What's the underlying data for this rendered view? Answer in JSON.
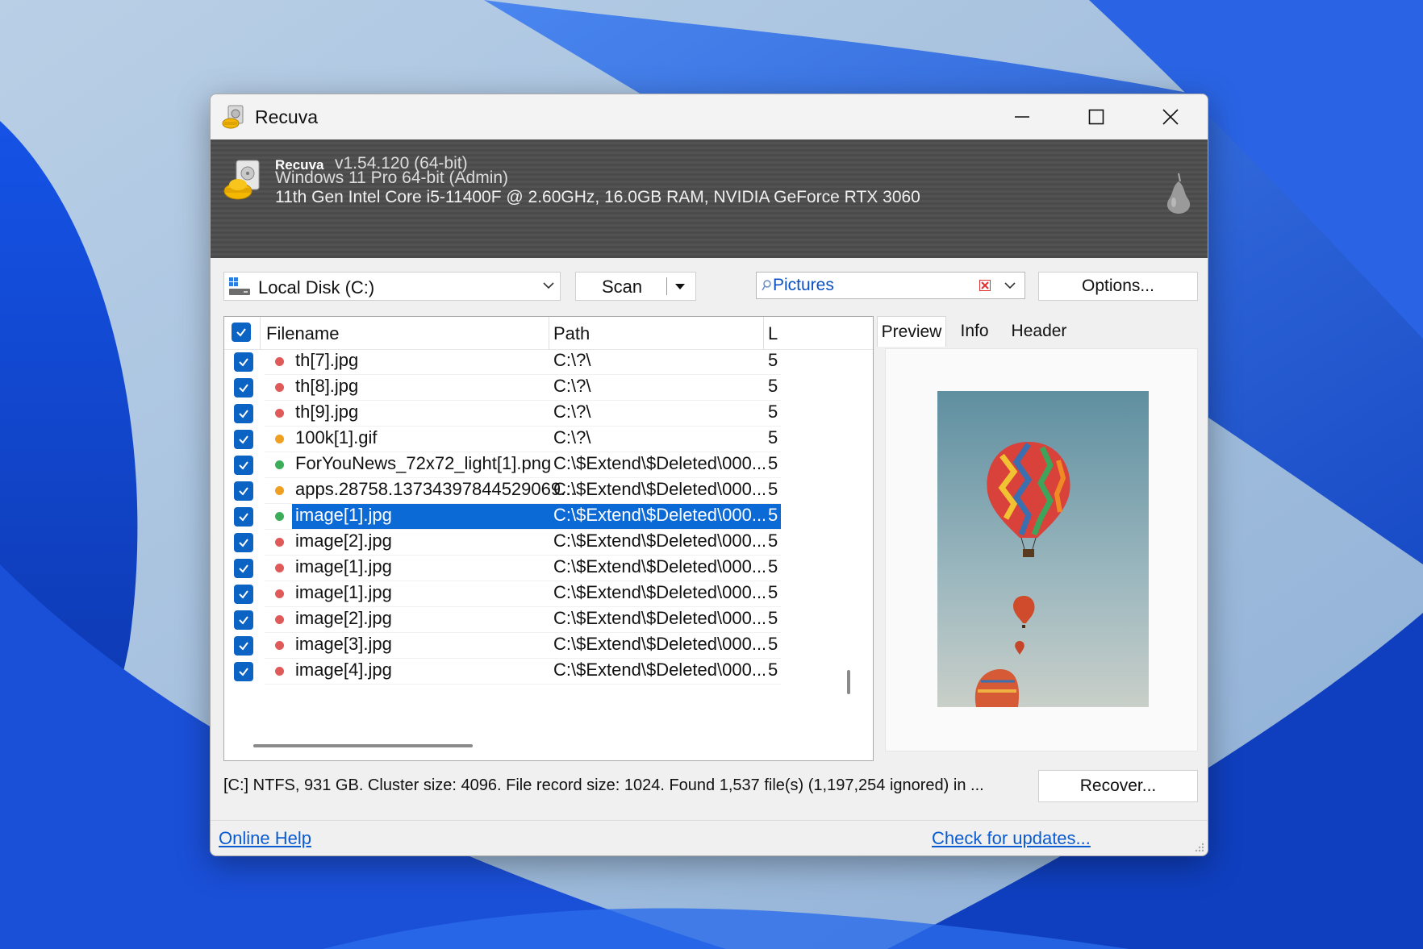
{
  "window": {
    "title": "Recuva"
  },
  "header": {
    "app_name": "Recuva",
    "version": "v1.54.120 (64-bit)",
    "os": "Windows 11 Pro 64-bit (Admin)",
    "hardware": "11th Gen Intel Core i5-11400F @ 2.60GHz, 16.0GB RAM, NVIDIA GeForce RTX 3060"
  },
  "toolbar": {
    "drive": "Local Disk (C:)",
    "scan_label": "Scan",
    "filter_value": "Pictures",
    "options_label": "Options..."
  },
  "list": {
    "columns": [
      "Filename",
      "Path",
      "L"
    ],
    "rows": [
      {
        "name": "th[7].jpg",
        "path": "C:\\?\\",
        "last": "5",
        "state": "red",
        "checked": true,
        "selected": false
      },
      {
        "name": "th[8].jpg",
        "path": "C:\\?\\",
        "last": "5",
        "state": "red",
        "checked": true,
        "selected": false
      },
      {
        "name": "th[9].jpg",
        "path": "C:\\?\\",
        "last": "5",
        "state": "red",
        "checked": true,
        "selected": false
      },
      {
        "name": "100k[1].gif",
        "path": "C:\\?\\",
        "last": "5",
        "state": "orange",
        "checked": true,
        "selected": false
      },
      {
        "name": "ForYouNews_72x72_light[1].png",
        "path": "C:\\$Extend\\$Deleted\\000...",
        "last": "5",
        "state": "green",
        "checked": true,
        "selected": false
      },
      {
        "name": "apps.28758.13734397844529069...",
        "path": "C:\\$Extend\\$Deleted\\000...",
        "last": "5",
        "state": "orange",
        "checked": true,
        "selected": false
      },
      {
        "name": "image[1].jpg",
        "path": "C:\\$Extend\\$Deleted\\000...",
        "last": "5",
        "state": "green",
        "checked": true,
        "selected": true
      },
      {
        "name": "image[2].jpg",
        "path": "C:\\$Extend\\$Deleted\\000...",
        "last": "5",
        "state": "red",
        "checked": true,
        "selected": false
      },
      {
        "name": "image[1].jpg",
        "path": "C:\\$Extend\\$Deleted\\000...",
        "last": "5",
        "state": "red",
        "checked": true,
        "selected": false
      },
      {
        "name": "image[1].jpg",
        "path": "C:\\$Extend\\$Deleted\\000...",
        "last": "5",
        "state": "red",
        "checked": true,
        "selected": false
      },
      {
        "name": "image[2].jpg",
        "path": "C:\\$Extend\\$Deleted\\000...",
        "last": "5",
        "state": "red",
        "checked": true,
        "selected": false
      },
      {
        "name": "image[3].jpg",
        "path": "C:\\$Extend\\$Deleted\\000...",
        "last": "5",
        "state": "red",
        "checked": true,
        "selected": false
      },
      {
        "name": "image[4].jpg",
        "path": "C:\\$Extend\\$Deleted\\000...",
        "last": "5",
        "state": "red",
        "checked": true,
        "selected": false
      }
    ]
  },
  "preview": {
    "tabs": [
      "Preview",
      "Info",
      "Header"
    ],
    "active_tab": "Preview"
  },
  "status": {
    "text": "[C:] NTFS, 931 GB. Cluster size: 4096. File record size: 1024. Found 1,537 file(s) (1,197,254 ignored) in ...",
    "recover_label": "Recover..."
  },
  "footer": {
    "help_link": "Online Help",
    "updates_link": "Check for updates..."
  },
  "colors": {
    "selection": "#0b6ad6",
    "checkbox": "#0b63c4",
    "state_red": "#e05a5a",
    "state_orange": "#f0a020",
    "state_green": "#3cae5a",
    "link": "#0a5bd0"
  }
}
